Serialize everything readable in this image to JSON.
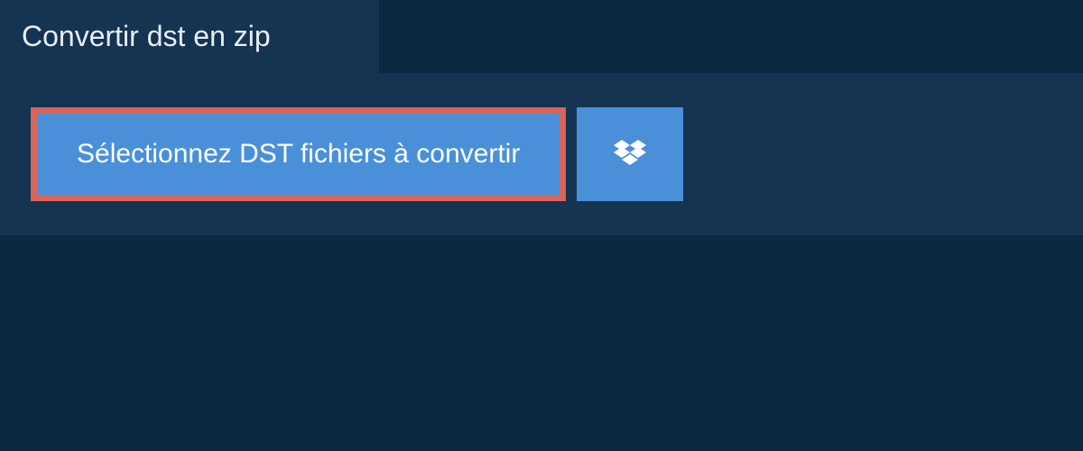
{
  "tab": {
    "label": "Convertir dst en zip"
  },
  "actions": {
    "select_files_label": "Sélectionnez DST fichiers à convertir"
  },
  "colors": {
    "page_bg": "#0d2841",
    "panel_bg": "#153451",
    "button_bg": "#4a90d9",
    "highlight_border": "#d96459"
  }
}
